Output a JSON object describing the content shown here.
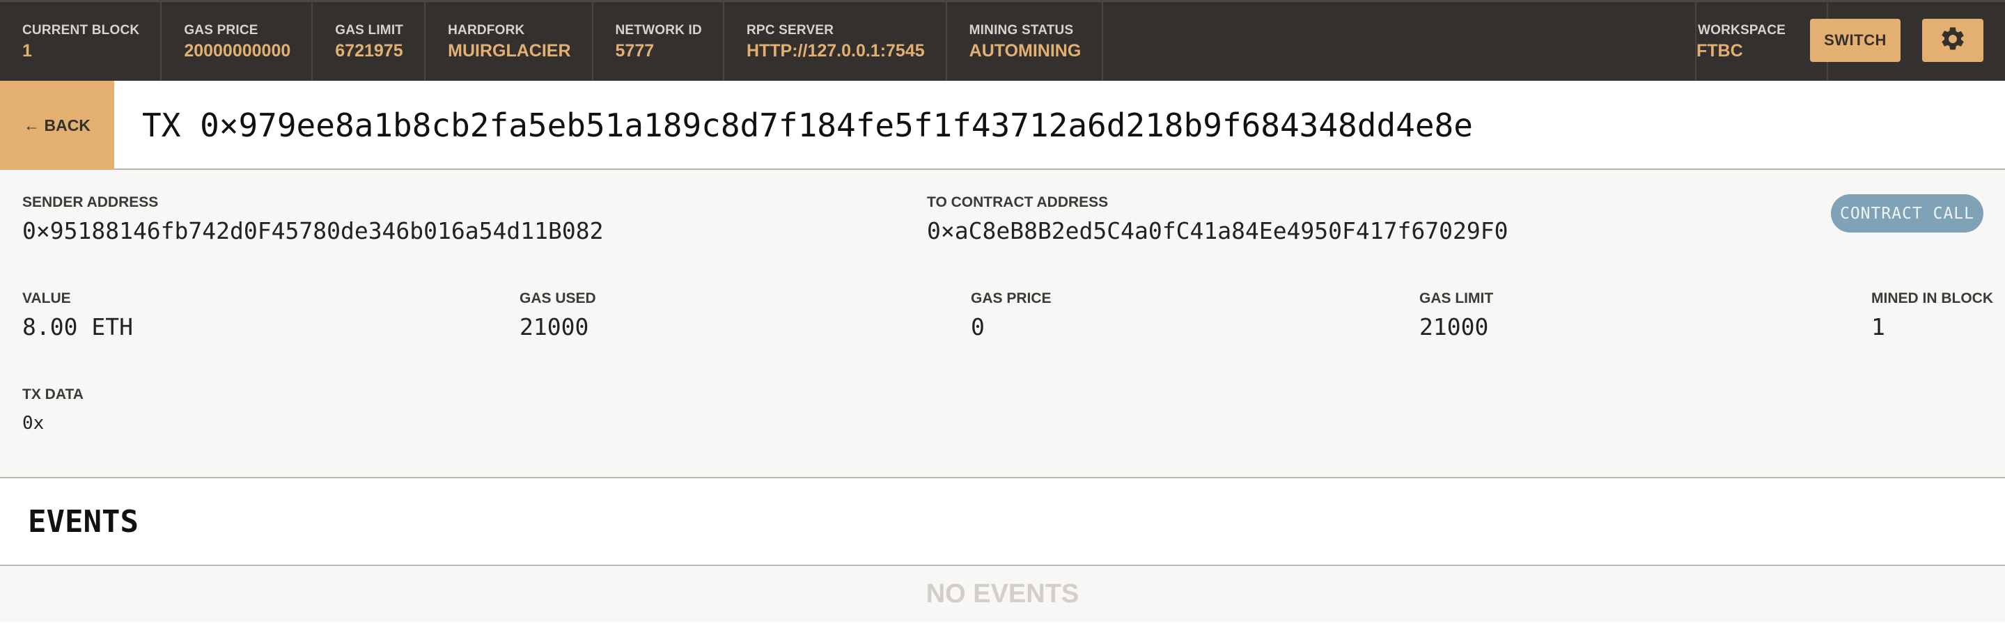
{
  "topbar": {
    "stats": [
      {
        "label": "CURRENT BLOCK",
        "value": "1"
      },
      {
        "label": "GAS PRICE",
        "value": "20000000000"
      },
      {
        "label": "GAS LIMIT",
        "value": "6721975"
      },
      {
        "label": "HARDFORK",
        "value": "MUIRGLACIER"
      },
      {
        "label": "NETWORK ID",
        "value": "5777"
      },
      {
        "label": "RPC SERVER",
        "value": "HTTP://127.0.0.1:7545"
      },
      {
        "label": "MINING STATUS",
        "value": "AUTOMINING"
      }
    ],
    "workspace": {
      "label": "WORKSPACE",
      "value": "FTBC"
    },
    "switch_label": "SWITCH",
    "settings_icon": "gear-icon"
  },
  "tx": {
    "back_label": "← BACK",
    "title": "TX 0×979ee8a1b8cb2fa5eb51a189c8d7f184fe5f1f43712a6d218b9f684348dd4e8e"
  },
  "details": {
    "sender": {
      "label": "SENDER ADDRESS",
      "value": "0×95188146fb742d0F45780de346b016a54d11B082"
    },
    "to_contract": {
      "label": "TO CONTRACT ADDRESS",
      "value": "0×aC8eB8B2ed5C4a0fC41a84Ee4950F417f67029F0"
    },
    "badge": "CONTRACT CALL",
    "value": {
      "label": "VALUE",
      "value": "8.00 ETH"
    },
    "gas_used": {
      "label": "GAS USED",
      "value": "21000"
    },
    "gas_price": {
      "label": "GAS PRICE",
      "value": "0"
    },
    "gas_limit": {
      "label": "GAS LIMIT",
      "value": "21000"
    },
    "mined_in_block": {
      "label": "MINED IN BLOCK",
      "value": "1"
    },
    "tx_data": {
      "label": "TX DATA",
      "value": "0x"
    }
  },
  "events": {
    "title": "EVENTS",
    "empty_label": "NO EVENTS"
  },
  "colors": {
    "topbar_bg": "#33302d",
    "accent": "#e4b071",
    "badge": "#7fa2b7"
  }
}
